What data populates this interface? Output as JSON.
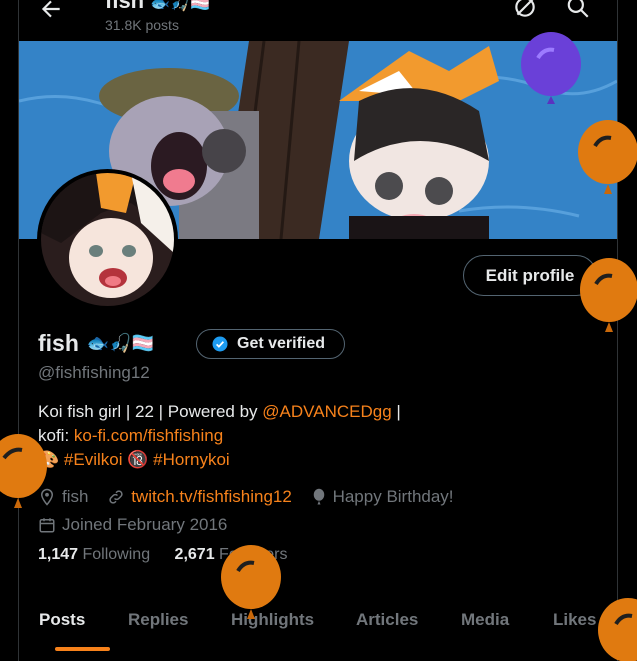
{
  "header": {
    "title": "fish",
    "post_count": "31.8K posts"
  },
  "profile": {
    "display_name": "fish",
    "handle": "@fishfishing12",
    "edit_label": "Edit profile",
    "verify_label": "Get verified",
    "bio_line1_text": "Koi fish girl  |  22  | Powered by ",
    "bio_line1_link": "@ADVANCEDgg",
    "bio_line1_tail": "  |",
    "bio_line2_text": "kofi: ",
    "bio_line2_link": "ko-fi.com/fishfishing",
    "bio_tag1": "#Evilkoi",
    "bio_tag2": "#Hornykoi",
    "location": "fish",
    "website": "twitch.tv/fishfishing12",
    "birthday": "Happy Birthday!",
    "joined": "Joined February 2016",
    "following_count": "1,147",
    "following_label": "Following",
    "followers_count": "2,671",
    "followers_label": "Followers"
  },
  "tabs": [
    "Posts",
    "Replies",
    "Highlights",
    "Articles",
    "Media",
    "Likes"
  ],
  "colors": {
    "accent": "#f7821b",
    "verified": "#1d9bf0",
    "balloon": "#e07a10",
    "balloon_purple": "#6a40d8"
  },
  "icons": [
    "back-arrow-icon",
    "refresh-icon",
    "search-icon",
    "verified-badge-icon",
    "location-icon",
    "link-icon",
    "balloon-icon",
    "calendar-icon"
  ]
}
